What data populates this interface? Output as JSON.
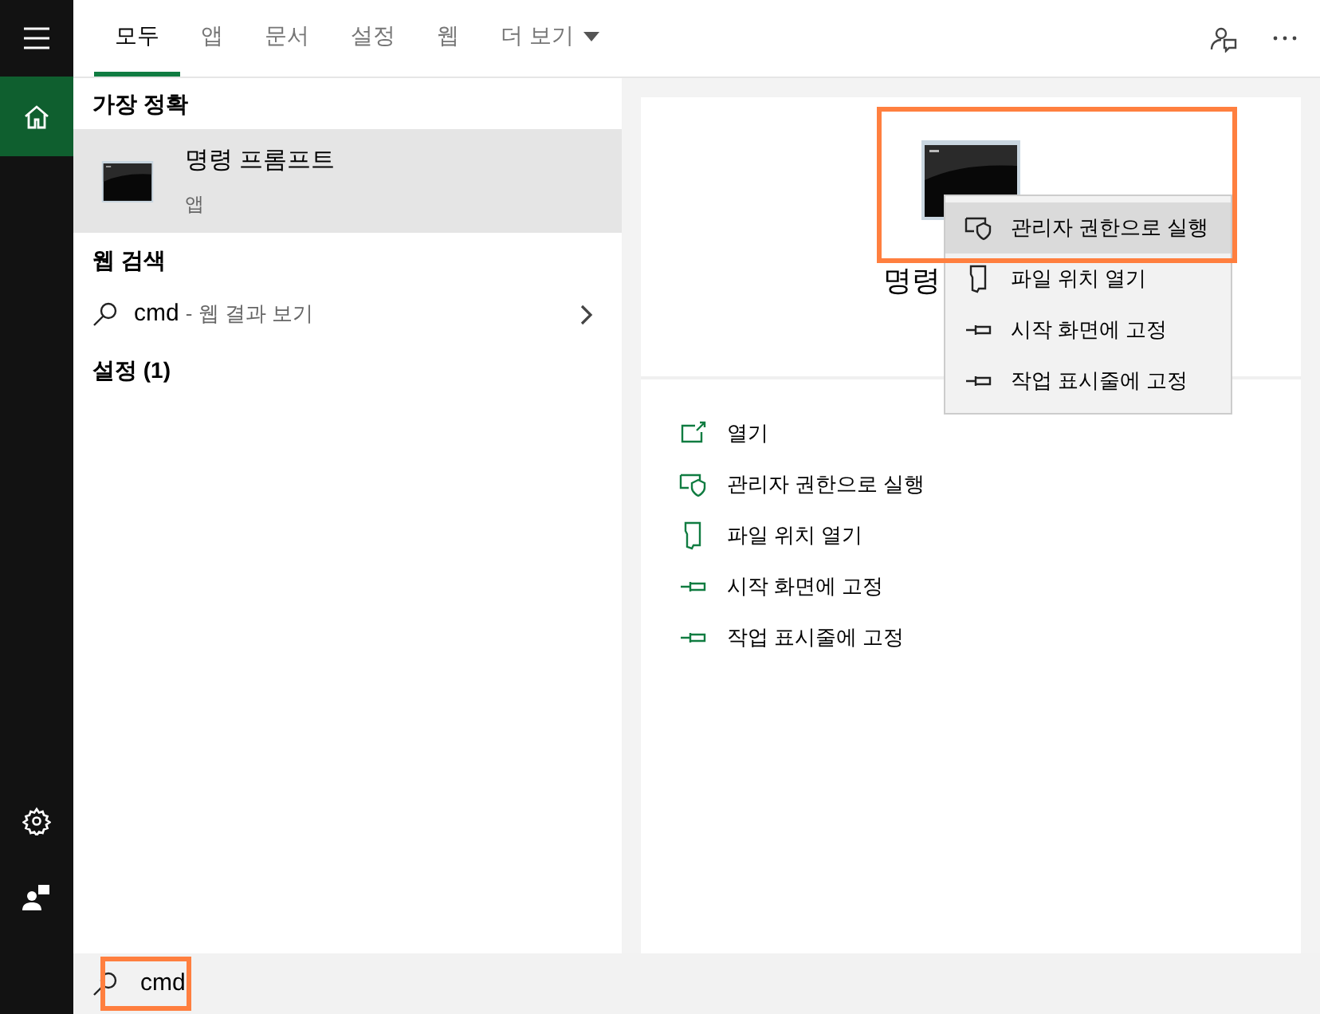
{
  "sidebar": {
    "items": [
      {
        "kind": "home",
        "selected": true
      },
      {
        "kind": "settings",
        "selected": false
      },
      {
        "kind": "account",
        "selected": false
      }
    ]
  },
  "tabs": [
    {
      "label": "모두",
      "selected": true
    },
    {
      "label": "앱",
      "selected": false
    },
    {
      "label": "문서",
      "selected": false
    },
    {
      "label": "설정",
      "selected": false
    },
    {
      "label": "웹",
      "selected": false
    }
  ],
  "more_tab": {
    "label": "더 보기"
  },
  "results": {
    "best_match": {
      "heading": "가장 정확",
      "item": {
        "title": "명령 프롬프트",
        "subtitle": "앱",
        "selected": true
      }
    },
    "web_search": {
      "heading": "웹 검색",
      "query": "cmd",
      "suffix": "- 웹 결과 보기"
    },
    "settings": {
      "heading": "설정 (1)"
    }
  },
  "detail": {
    "title": "명령",
    "actions": [
      {
        "kind": "open",
        "label": "열기"
      },
      {
        "kind": "admin",
        "label": "관리자 권한으로 실행"
      },
      {
        "kind": "folder",
        "label": "파일 위치 열기"
      },
      {
        "kind": "pin",
        "label": "시작 화면에 고정"
      },
      {
        "kind": "pin",
        "label": "작업 표시줄에 고정"
      }
    ]
  },
  "context_menu": {
    "items": [
      {
        "kind": "admin",
        "label": "관리자 권한으로 실행",
        "selected": true
      },
      {
        "kind": "folder",
        "label": "파일 위치 열기",
        "selected": false
      },
      {
        "kind": "pin",
        "label": "시작 화면에 고정",
        "selected": false
      },
      {
        "kind": "pin",
        "label": "작업 표시줄에 고정",
        "selected": false
      }
    ]
  },
  "search": {
    "value": "cmd"
  }
}
